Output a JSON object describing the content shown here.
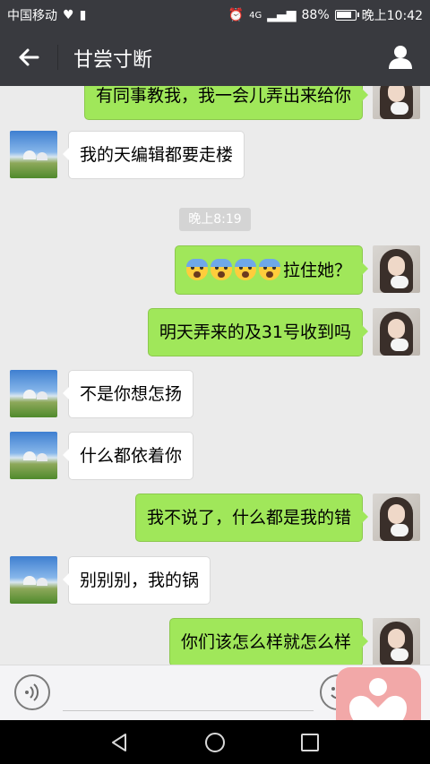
{
  "status_bar": {
    "carrier": "中国移动",
    "signal_text": "4G",
    "battery": "88%",
    "battery_level": 0.88,
    "time": "晚上10:42"
  },
  "header": {
    "title": "甘尝寸断"
  },
  "messages": [
    {
      "side": "out",
      "text": "有同事教我，我一会儿弄出来给你"
    },
    {
      "side": "in",
      "text": "我的天编辑都要走楼"
    },
    {
      "type": "time",
      "text": "晚上8:19"
    },
    {
      "side": "out",
      "text": "拉住她？",
      "emoji_count": 4
    },
    {
      "side": "out",
      "text": "明天弄来的及31号收到吗"
    },
    {
      "side": "in",
      "text": "不是你想怎扬"
    },
    {
      "side": "in",
      "text": "什么都依着你"
    },
    {
      "side": "out",
      "text": "我不说了，什么都是我的错"
    },
    {
      "side": "in",
      "text": "别别别，我的锅"
    },
    {
      "side": "out",
      "text": "你们该怎么样就怎么样"
    }
  ],
  "icons": {
    "back": "arrow-left-icon",
    "profile": "person-icon",
    "voice": "voice-icon",
    "emoji": "emoji-icon",
    "nav_back": "triangle-back-icon",
    "nav_home": "circle-home-icon",
    "nav_recent": "square-recent-icon"
  },
  "colors": {
    "header_bg": "#393a3f",
    "bubble_out": "#a0e75a",
    "bubble_in": "#ffffff",
    "chat_bg": "#ebebeb",
    "overlay_logo": "#f2a8a8"
  }
}
